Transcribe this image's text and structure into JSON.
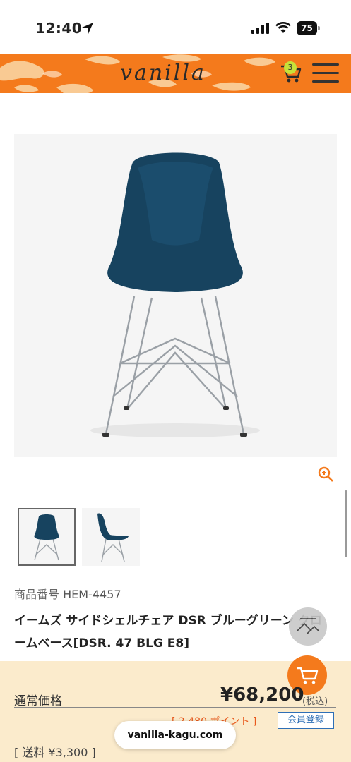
{
  "status_bar": {
    "time": "12:40",
    "battery": "75"
  },
  "header": {
    "logo": "vanilla",
    "cart_count": "3"
  },
  "product": {
    "sku_label": "商品番号",
    "sku": "HEM-4457",
    "title": "イームズ サイドシェルチェア DSR ブルーグリーン クロームベース[DSR. 47 BLG E8]"
  },
  "pricing": {
    "regular_label": "通常価格",
    "price": "¥68,200",
    "tax_note": "(税込)",
    "points": "[ 2,480 ポイント ]",
    "member_button": "会員登録",
    "shipping": "[ 送料 ¥3,300 ]"
  },
  "browser": {
    "domain": "vanilla-kagu.com"
  },
  "colors": {
    "brand_orange": "#f47a1c",
    "price_bg": "#fbebcc",
    "chair_blue": "#17435f"
  },
  "icons": [
    "location-arrow-icon",
    "signal-icon",
    "wifi-icon",
    "battery-icon",
    "cart-icon",
    "menu-icon",
    "zoom-in-icon",
    "back-to-top-icon",
    "cart-fab-icon"
  ]
}
